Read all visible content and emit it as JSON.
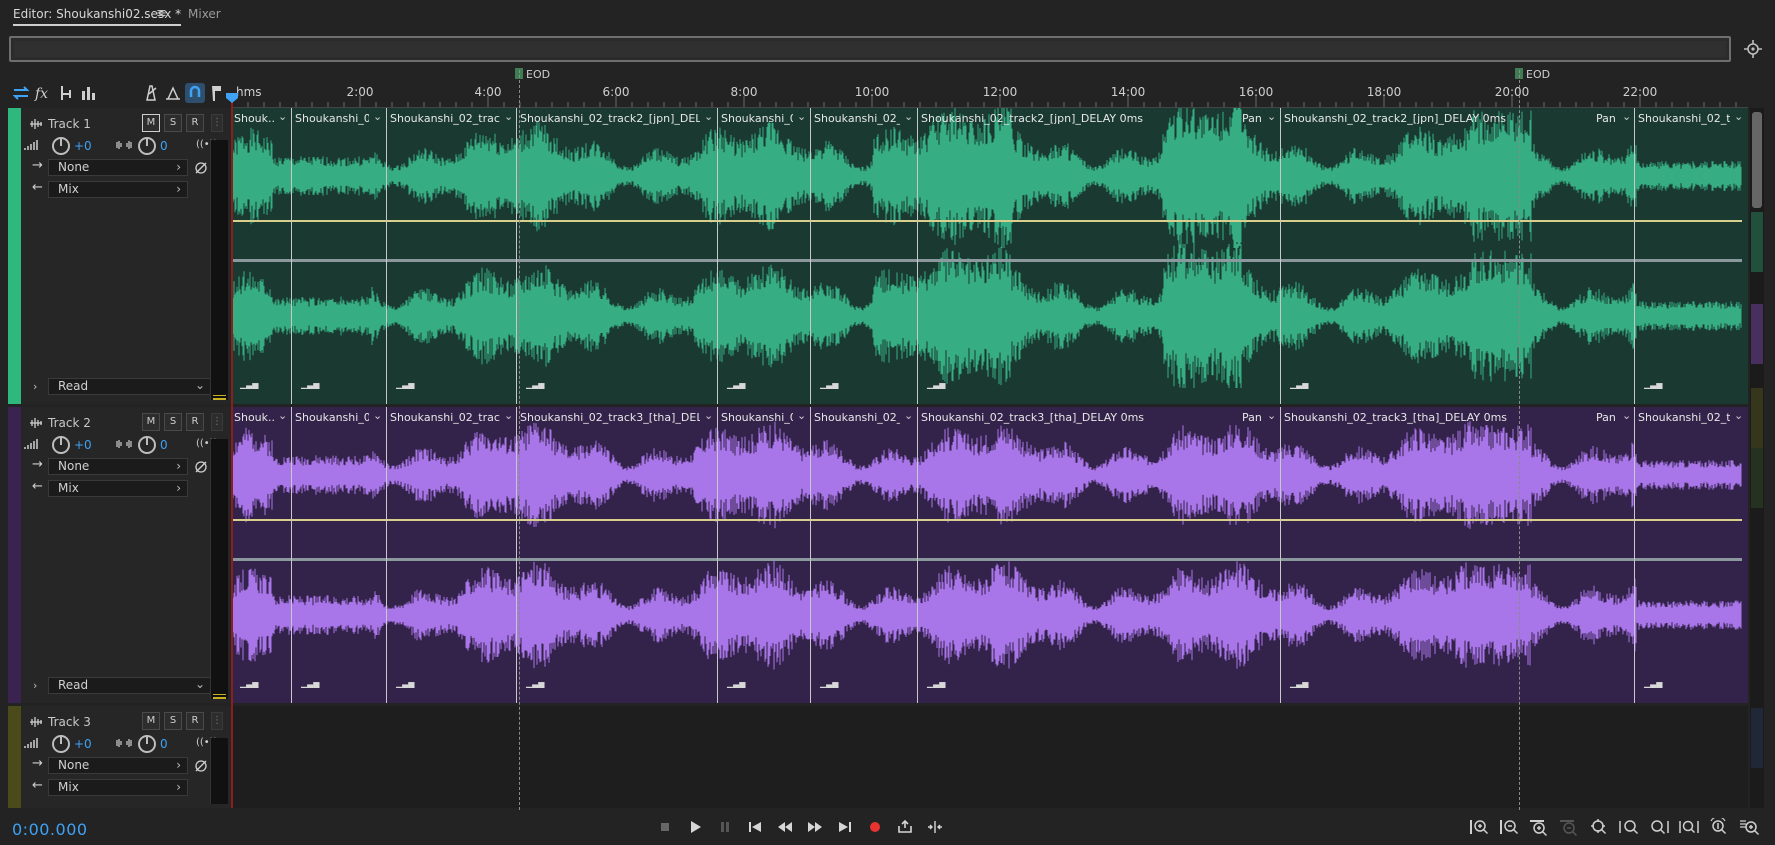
{
  "tabs": {
    "editor": "Editor: Shoukanshi02.sesx *",
    "mixer": "Mixer"
  },
  "ruler": {
    "units": "hms",
    "ticks": [
      "2:00",
      "4:00",
      "6:00",
      "8:00",
      "10:00",
      "12:00",
      "14:00",
      "16:00",
      "18:00",
      "20:00",
      "22:00"
    ],
    "eod_marker_1": "EOD",
    "eod_marker_2": "EOD"
  },
  "tracks": [
    {
      "name": "Track 1",
      "mute": "M",
      "solo": "S",
      "record": "R",
      "volume": "+0",
      "pan": "0",
      "input": "None",
      "output": "Mix",
      "automation": "Read",
      "color": "#2fb87e",
      "clips": [
        "Shouk...",
        "Shoukanshi_0...",
        "Shoukanshi_02_track2...",
        "Shoukanshi_02_track2_[jpn]_DELAY 0ms",
        "Shoukanshi_0...",
        "Shoukanshi_02_t...",
        "Shoukanshi_02_track2_[jpn]_DELAY 0ms",
        "Shoukanshi_02_track2_[jpn]_DELAY 0ms",
        "Shoukanshi_02_tr..."
      ],
      "pan_label_1": "Pan",
      "pan_label_2": "Pan"
    },
    {
      "name": "Track 2",
      "mute": "M",
      "solo": "S",
      "record": "R",
      "volume": "+0",
      "pan": "0",
      "input": "None",
      "output": "Mix",
      "automation": "Read",
      "color": "#9a57e0",
      "clips": [
        "Shouk...",
        "Shoukanshi_0...",
        "Shoukanshi_02_track3...",
        "Shoukanshi_02_track3_[tha]_DELAY 0ms",
        "Shoukanshi_0...",
        "Shoukanshi_02_t...",
        "Shoukanshi_02_track3_[tha]_DELAY 0ms",
        "Shoukanshi_02_track3_[tha]_DELAY 0ms",
        "Shoukanshi_02_tr..."
      ],
      "pan_label_1": "Pan",
      "pan_label_2": "Pan"
    },
    {
      "name": "Track 3",
      "mute": "M",
      "solo": "S",
      "record": "R",
      "volume": "+0",
      "pan": "0",
      "input": "None",
      "output": "Mix",
      "color": "#6b6a1f"
    }
  ],
  "transport": {
    "time": "0:00.000"
  },
  "icons": {
    "toolbar": [
      "swap-icon",
      "fx-icon",
      "sends-icon",
      "eq-icon",
      "metronome-icon",
      "snap-icon",
      "loop-icon",
      "marker-icon"
    ],
    "transport": [
      "stop-icon",
      "play-icon",
      "pause-icon",
      "go-to-start-icon",
      "rewind-icon",
      "fast-forward-icon",
      "go-to-end-icon",
      "record-icon",
      "loop-playback-icon",
      "skip-icon"
    ],
    "zoom": [
      "zoom-in-amplitude-icon",
      "zoom-out-amplitude-icon",
      "zoom-in-time-icon",
      "zoom-out-time-icon",
      "zoom-selection-icon",
      "zoom-in-left-icon",
      "zoom-in-right-icon",
      "zoom-out-full-icon",
      "zoom-in-playhead-icon",
      "zoom-in-tracks-icon"
    ]
  }
}
